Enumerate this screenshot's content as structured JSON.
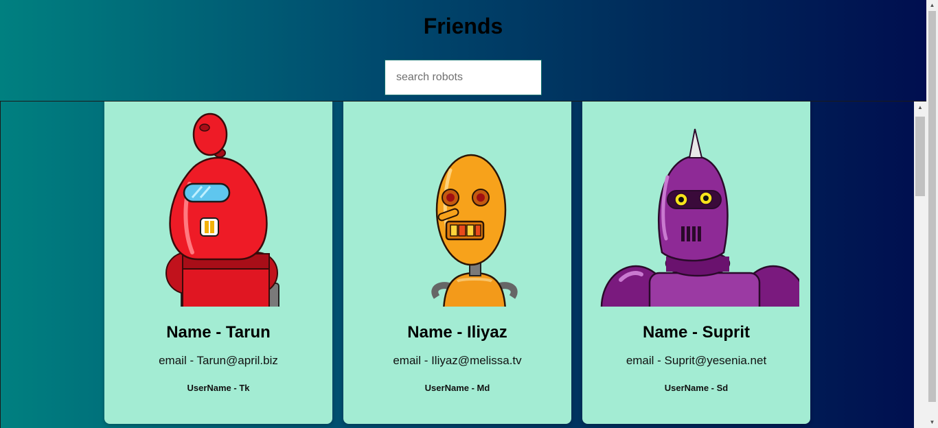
{
  "header": {
    "title": "Friends"
  },
  "search": {
    "placeholder": "search robots",
    "value": ""
  },
  "robots": [
    {
      "name": "Name - Tarun",
      "email": "email - Tarun@april.biz",
      "username": "UserName - Tk",
      "avatar_icon": "red-robot-avatar"
    },
    {
      "name": "Name - Iliyaz",
      "email": "email - Iliyaz@melissa.tv",
      "username": "UserName - Md",
      "avatar_icon": "orange-robot-avatar"
    },
    {
      "name": "Name - Suprit",
      "email": "email - Suprit@yesenia.net",
      "username": "UserName - Sd",
      "avatar_icon": "purple-robot-avatar"
    }
  ],
  "colors": {
    "gradient_start": "#008080",
    "gradient_end": "#000d4f",
    "card_background": "#a3ecd3"
  }
}
